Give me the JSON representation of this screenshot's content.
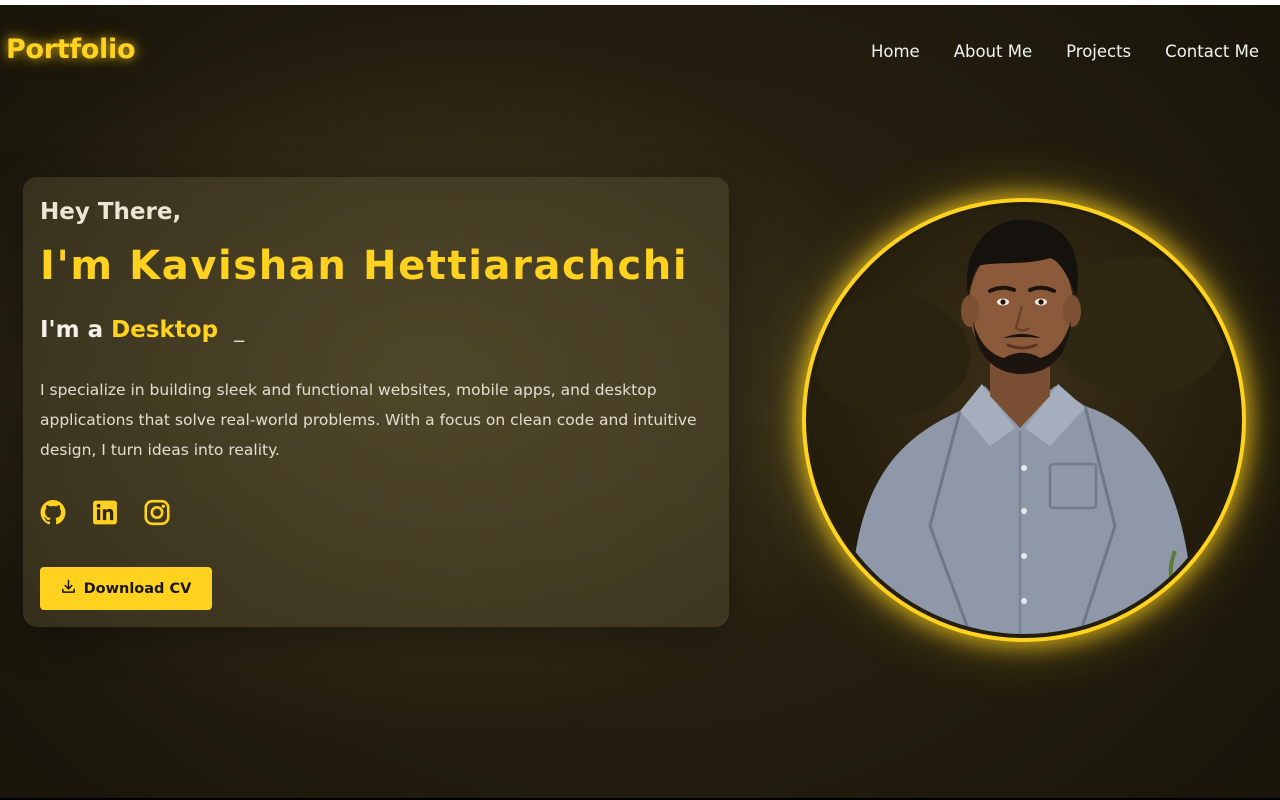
{
  "header": {
    "logo": "Portfolio",
    "nav": [
      {
        "label": "Home"
      },
      {
        "label": "About Me"
      },
      {
        "label": "Projects"
      },
      {
        "label": "Contact Me"
      }
    ]
  },
  "hero": {
    "greeting": "Hey There,",
    "name": "I'm Kavishan Hettiarachchi",
    "role_prefix": "I'm a",
    "role_word": "Desktop",
    "typing_cursor": "_",
    "description": "I specialize in building sleek and functional websites, mobile apps, and desktop applications that solve real-world problems. With a focus on clean code and intuitive design, I turn ideas into reality.",
    "socials": [
      {
        "icon": "github-icon"
      },
      {
        "icon": "linkedin-icon"
      },
      {
        "icon": "instagram-icon"
      }
    ],
    "download_label": "Download CV",
    "download_icon": "download-icon"
  },
  "colors": {
    "accent": "#ffd21f",
    "background": "#211c0e",
    "card": "#4a432a",
    "text": "#f0ece0"
  }
}
